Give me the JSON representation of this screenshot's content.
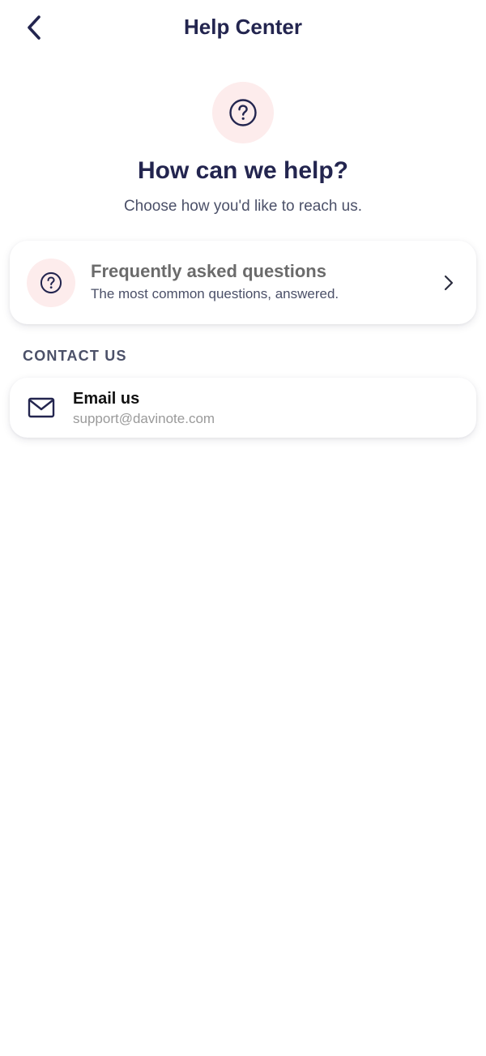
{
  "header": {
    "title": "Help Center",
    "back_icon": "chevron-left-icon"
  },
  "hero": {
    "icon": "question-circle-icon",
    "title": "How can we help?",
    "subtitle": "Choose how you'd like to reach us."
  },
  "faq": {
    "icon": "question-circle-icon",
    "title": "Frequently asked questions",
    "description": "The most common questions, answered.",
    "chevron_icon": "chevron-right-icon"
  },
  "contact": {
    "section_label": "CONTACT US",
    "email": {
      "icon": "mail-icon",
      "title": "Email us",
      "address": "support@davinote.com"
    }
  },
  "colors": {
    "primary": "#23254f",
    "icon_background": "#fdecec",
    "muted_text": "#4b5068",
    "email_address": "#9a9a9a"
  }
}
